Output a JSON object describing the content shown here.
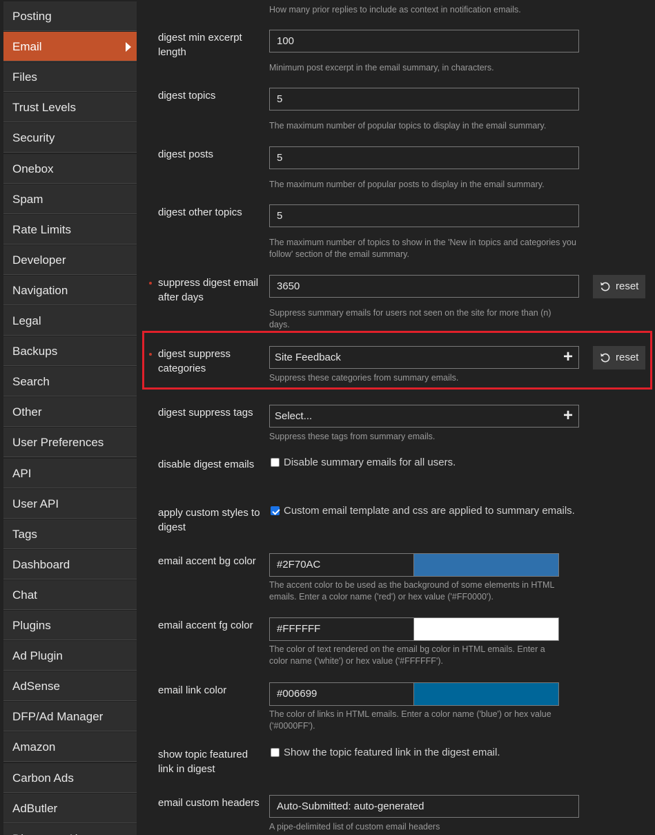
{
  "sidebar": {
    "items": [
      {
        "label": "Posting"
      },
      {
        "label": "Email",
        "active": true
      },
      {
        "label": "Files"
      },
      {
        "label": "Trust Levels"
      },
      {
        "label": "Security"
      },
      {
        "label": "Onebox"
      },
      {
        "label": "Spam"
      },
      {
        "label": "Rate Limits"
      },
      {
        "label": "Developer"
      },
      {
        "label": "Navigation"
      },
      {
        "label": "Legal"
      },
      {
        "label": "Backups"
      },
      {
        "label": "Search"
      },
      {
        "label": "Other"
      },
      {
        "label": "User Preferences"
      },
      {
        "label": "API"
      },
      {
        "label": "User API"
      },
      {
        "label": "Tags"
      },
      {
        "label": "Dashboard"
      },
      {
        "label": "Chat"
      },
      {
        "label": "Plugins"
      },
      {
        "label": "Ad Plugin"
      },
      {
        "label": "AdSense"
      },
      {
        "label": "DFP/Ad Manager"
      },
      {
        "label": "Amazon"
      },
      {
        "label": "Carbon Ads"
      },
      {
        "label": "AdButler"
      },
      {
        "label": "Discourse Ai"
      }
    ]
  },
  "settings": {
    "top_desc": "How many prior replies to include as context in notification emails.",
    "digest_min_excerpt_length": {
      "label": "digest min excerpt length",
      "value": "100",
      "desc": "Minimum post excerpt in the email summary, in characters."
    },
    "digest_topics": {
      "label": "digest topics",
      "value": "5",
      "desc": "The maximum number of popular topics to display in the email summary."
    },
    "digest_posts": {
      "label": "digest posts",
      "value": "5",
      "desc": "The maximum number of popular posts to display in the email summary."
    },
    "digest_other_topics": {
      "label": "digest other topics",
      "value": "5",
      "desc": "The maximum number of topics to show in the 'New in topics and categories you follow' section of the email summary."
    },
    "suppress_digest_email_after_days": {
      "label": "suppress digest email after days",
      "value": "3650",
      "reset": "reset",
      "desc": "Suppress summary emails for users not seen on the site for more than (n) days."
    },
    "digest_suppress_categories": {
      "label": "digest suppress categories",
      "value": "Site Feedback",
      "reset": "reset",
      "desc": "Suppress these categories from summary emails."
    },
    "digest_suppress_tags": {
      "label": "digest suppress tags",
      "value": "Select...",
      "desc": "Suppress these tags from summary emails."
    },
    "disable_digest_emails": {
      "label": "disable digest emails",
      "checked": false,
      "check_label": "Disable summary emails for all users."
    },
    "apply_custom_styles_to_digest": {
      "label": "apply custom styles to digest",
      "checked": true,
      "check_label": "Custom email template and css are applied to summary emails."
    },
    "email_accent_bg_color": {
      "label": "email accent bg color",
      "value": "#2F70AC",
      "swatch": "#2F70AC",
      "desc": "The accent color to be used as the background of some elements in HTML emails. Enter a color name ('red') or hex value ('#FF0000')."
    },
    "email_accent_fg_color": {
      "label": "email accent fg color",
      "value": "#FFFFFF",
      "swatch": "#FFFFFF",
      "desc": "The color of text rendered on the email bg color in HTML emails. Enter a color name ('white') or hex value ('#FFFFFF')."
    },
    "email_link_color": {
      "label": "email link color",
      "value": "#006699",
      "swatch": "#006699",
      "desc": "The color of links in HTML emails. Enter a color name ('blue') or hex value ('#0000FF')."
    },
    "show_topic_featured_link_in_digest": {
      "label": "show topic featured link in digest",
      "checked": false,
      "check_label": "Show the topic featured link in the digest email."
    },
    "email_custom_headers": {
      "label": "email custom headers",
      "value": "Auto-Submitted: auto-generated",
      "desc": "A pipe-delimited list of custom email headers"
    }
  },
  "colors": {
    "active_nav": "#c2522a",
    "highlight_border": "#e0202a",
    "changed_dot": "#c23a2a"
  }
}
